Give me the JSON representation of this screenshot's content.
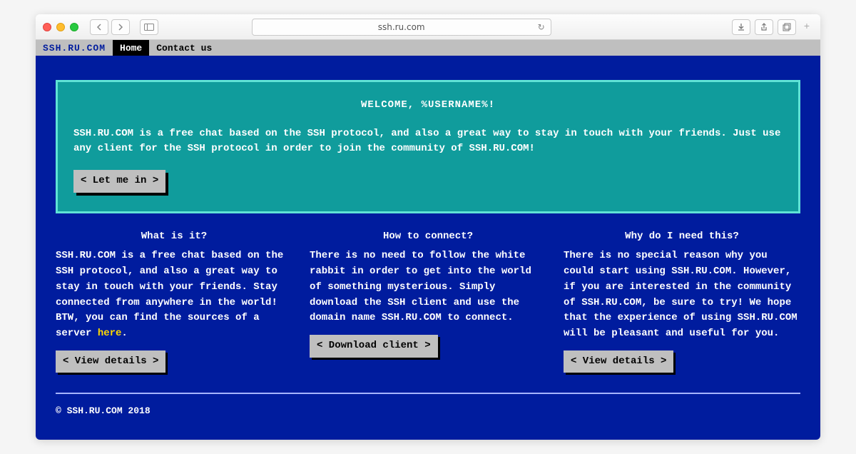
{
  "browser": {
    "address": "ssh.ru.com"
  },
  "menubar": {
    "brand": "SSH.RU.COM",
    "items": [
      {
        "label": "Home",
        "active": true
      },
      {
        "label": "Contact us",
        "active": false
      }
    ]
  },
  "hero": {
    "title": "WELCOME, %USERNAME%!",
    "body": "SSH.RU.COM is a free chat based on the SSH protocol, and also a great way to stay in touch with your friends. Just use any client for the SSH protocol in order to join the community of SSH.RU.COM!",
    "cta": "< Let me in >"
  },
  "columns": [
    {
      "title": "What is it?",
      "body": "SSH.RU.COM is a free chat based on the SSH protocol, and also a great way to stay in touch with your friends. Stay connected from anywhere in the world! BTW, you can find the sources of a server ",
      "link_text": "here",
      "link_after": ".",
      "button": "< View details >"
    },
    {
      "title": "How to connect?",
      "body": "There is no need to follow the white rabbit in order to get into the world of something mysterious. Simply download the SSH client and use the domain name SSH.RU.COM to connect.",
      "button": "< Download client >"
    },
    {
      "title": "Why do I need this?",
      "body": "There is no special reason why you could start using SSH.RU.COM. However, if you are interested in the community of SSH.RU.COM, be sure to try! We hope that the experience of using SSH.RU.COM will be pleasant and useful for you.",
      "button": "< View details >"
    }
  ],
  "footer": "© SSH.RU.COM 2018"
}
